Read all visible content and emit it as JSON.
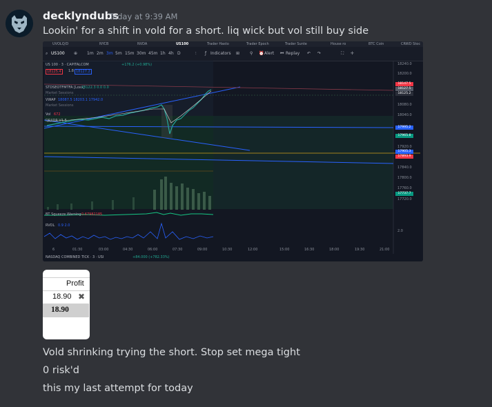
{
  "message": {
    "username": "decklyndubs",
    "timestamp": "Today at 9:39 AM",
    "line1": "Lookin' for a shift in vold for a short. liq wick but vol still buy side",
    "line2": "Vold shrinking trying the short. Stop set mega tight",
    "line3": "0 risk'd",
    "line4": "this my last attempt for today"
  },
  "chart": {
    "tabs": [
      "UVOLQ/D",
      "NYCB",
      "NVDA",
      "US100",
      "Trader Hasto",
      "Trader Epoch",
      "Trader Sunte",
      "House ro",
      "BTC Coin",
      "CRWD Stoc"
    ],
    "symbol": "US100",
    "timeframes": [
      "1m",
      "2m",
      "3m",
      "5m",
      "15m",
      "30m",
      "45m",
      "1h",
      "4h",
      "D"
    ],
    "indicators_label": "Indicators",
    "alert_label": "Alert",
    "replay_label": "Replay",
    "title": "US 100 · 3 · CAPITALCOM",
    "change": "+176.2 (+0.98%)",
    "bid": "18125.4",
    "spread": "1.8",
    "ask": "18127.2",
    "ind1": "STDSEOTFMTFA [Loxx]",
    "ind1_vals": "18122.3  0.0  0.0",
    "vwap_label": "VWAP",
    "vwap_vals": "18087.5  18203.1  17942.0",
    "vol_label": "Vol",
    "vol_val": "672",
    "drider_label": "DR/IDR V1.5",
    "market_sessions": "Market Sessions",
    "price_labels": [
      "18240.0",
      "18200.0",
      "18080.0",
      "18040.0",
      "17920.0",
      "17840.0",
      "17800.0",
      "17760.0",
      "17720.0"
    ],
    "price_badges": [
      {
        "text": "18147.5",
        "color": "#f23645"
      },
      {
        "text": "18127.5",
        "color": "#555a66"
      },
      {
        "text": "18125.2",
        "color": "#2a2e39"
      },
      {
        "text": "17995.2",
        "color": "#2962ff"
      },
      {
        "text": "17965.8",
        "color": "#089981"
      },
      {
        "text": "17905.3",
        "color": "#2962ff"
      },
      {
        "text": "17893.9",
        "color": "#f23645"
      },
      {
        "text": "17737.7",
        "color": "#089981"
      }
    ],
    "squeeze_label": "BT Squeeze Warning",
    "squeeze_val": "0.67982185",
    "rvol_label": "RVOL",
    "rvol_vals": "0.9  2.0",
    "rvol_axis": "2.0",
    "time_labels": [
      "6",
      "01:30",
      "03:00",
      "04:30",
      "06:00",
      "07:30",
      "09:00",
      "10:30",
      "12:00",
      "15:00",
      "16:30",
      "18:00",
      "19:30",
      "21:00"
    ],
    "footer_label": "NASDAQ COMBINED TICK · 3 · USI",
    "footer_val": "+84.000 (+782.33%)"
  },
  "card": {
    "header": "Profit",
    "value": "18.90",
    "total": "18.90"
  }
}
